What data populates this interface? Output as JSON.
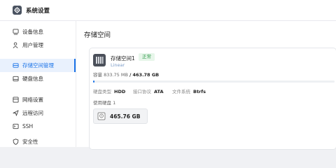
{
  "app": {
    "title": "系统设置",
    "icon": "gear-icon"
  },
  "sidebar": {
    "items": [
      {
        "label": "设备信息",
        "icon": "device-icon",
        "active": false
      },
      {
        "label": "用户管理",
        "icon": "user-icon",
        "active": false
      },
      {
        "label": "存储空间管理",
        "icon": "storage-icon",
        "active": true
      },
      {
        "label": "硬盘信息",
        "icon": "disk-icon",
        "active": false
      },
      {
        "label": "网络设置",
        "icon": "network-icon",
        "active": false
      },
      {
        "label": "远程访问",
        "icon": "remote-access-icon",
        "active": false
      },
      {
        "label": "SSH",
        "icon": "terminal-icon",
        "active": false
      },
      {
        "label": "安全性",
        "icon": "shield-icon",
        "active": false
      }
    ]
  },
  "main": {
    "title": "存储空间",
    "pool": {
      "name": "存储空间1",
      "status": "正常",
      "type": "Linear",
      "capacity_label": "容量",
      "used": "833.75 MB",
      "separator": "/",
      "total": "463.78 GB",
      "used_fraction": 0.0018,
      "meta": {
        "disk_type_label": "硬盘类型",
        "disk_type": "HDD",
        "interface_label": "接口协议",
        "interface": "ATA",
        "fs_label": "文件系统",
        "fs": "Btrfs"
      },
      "disks_label": "使用硬盘 1",
      "disks": [
        {
          "size": "465.76 GB",
          "icon": "hard-drive-icon"
        }
      ]
    }
  },
  "colors": {
    "accent": "#1a73e8",
    "status_ok": "#2f9a4a",
    "sidebar_active_bg": "#e9f1fd"
  }
}
